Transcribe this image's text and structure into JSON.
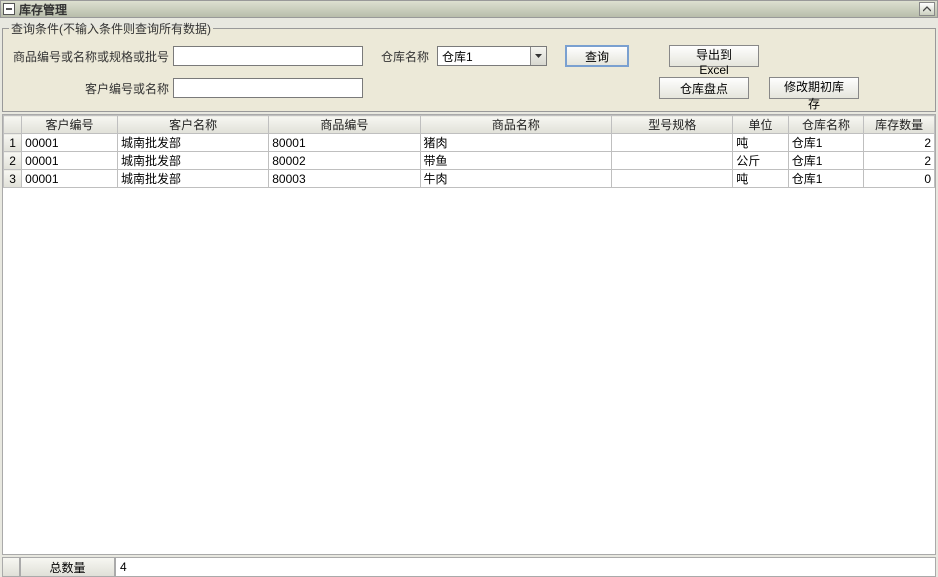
{
  "window": {
    "title": "库存管理"
  },
  "filters": {
    "legend": "查询条件(不输入条件则查询所有数据)",
    "label_product": "商品编号或名称或规格或批号",
    "value_product": "",
    "label_warehouse": "仓库名称",
    "warehouse_selected": "仓库1",
    "label_customer": "客户编号或名称",
    "value_customer": "",
    "btn_query": "查询",
    "btn_export": "导出到Excel",
    "btn_stocktake": "仓库盘点",
    "btn_edit_initial": "修改期初库存"
  },
  "grid": {
    "columns": [
      "客户编号",
      "客户名称",
      "商品编号",
      "商品名称",
      "型号规格",
      "单位",
      "仓库名称",
      "库存数量"
    ],
    "rows": [
      {
        "idx": "1",
        "cust_no": "00001",
        "cust_name": "城南批发部",
        "prod_no": "80001",
        "prod_name": "猪肉",
        "spec": "",
        "unit": "吨",
        "wh": "仓库1",
        "qty": "2"
      },
      {
        "idx": "2",
        "cust_no": "00001",
        "cust_name": "城南批发部",
        "prod_no": "80002",
        "prod_name": "带鱼",
        "spec": "",
        "unit": "公斤",
        "wh": "仓库1",
        "qty": "2"
      },
      {
        "idx": "3",
        "cust_no": "00001",
        "cust_name": "城南批发部",
        "prod_no": "80003",
        "prod_name": "牛肉",
        "spec": "",
        "unit": "吨",
        "wh": "仓库1",
        "qty": "0"
      }
    ]
  },
  "footer": {
    "label_total": "总数量",
    "total_value": "4"
  }
}
